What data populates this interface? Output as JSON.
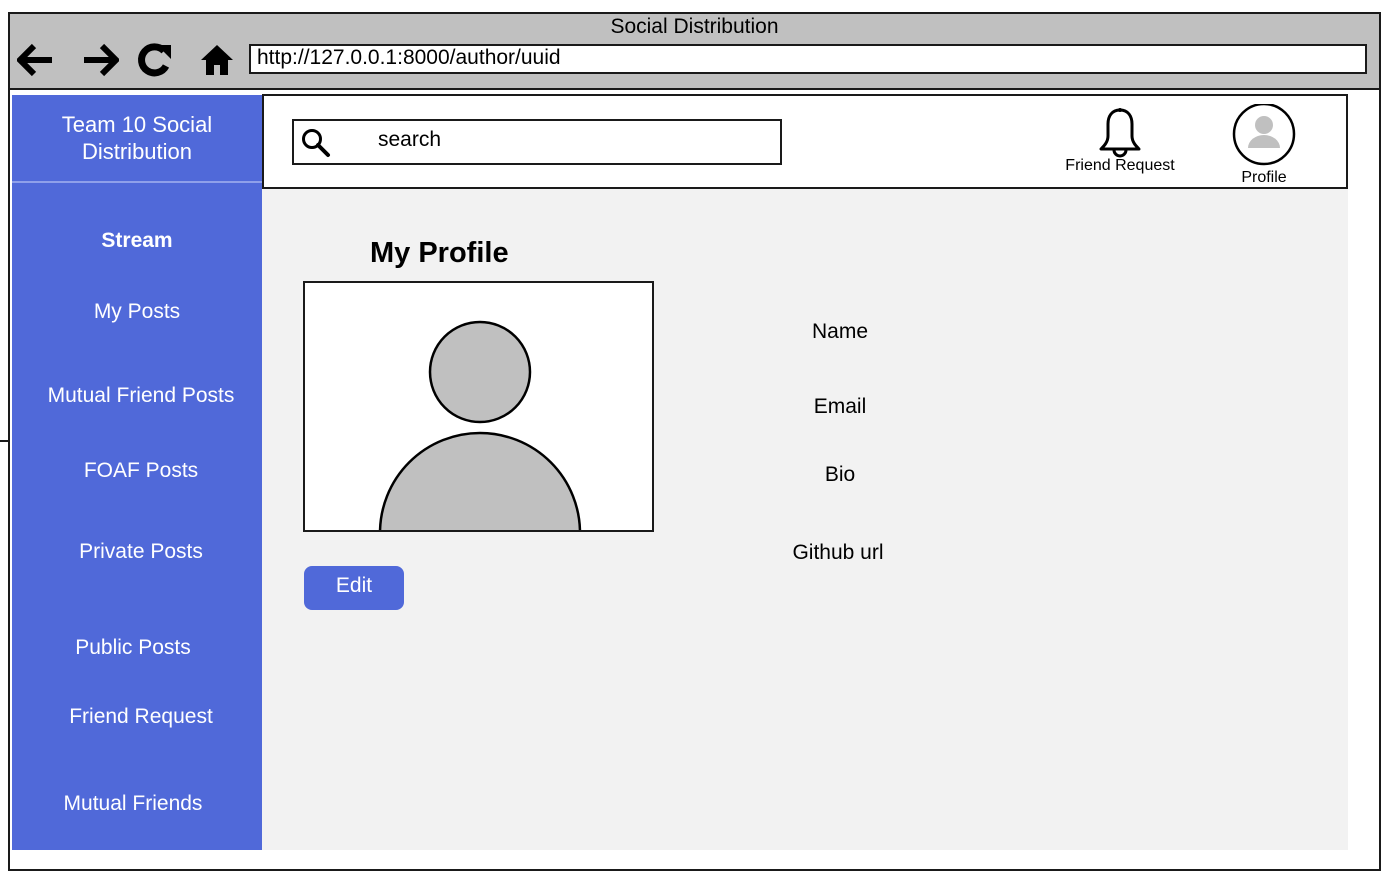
{
  "window": {
    "title": "Social Distribution",
    "url": "http://127.0.0.1:8000/author/uuid"
  },
  "nav_icons": [
    "back-arrow-icon",
    "forward-arrow-icon",
    "reload-icon",
    "home-icon"
  ],
  "sidebar": {
    "brand": "Team 10 Social Distribution",
    "items": [
      {
        "label": "Stream",
        "active": true
      },
      {
        "label": "My Posts",
        "active": false
      },
      {
        "label": "Mutual Friend Posts",
        "active": false
      },
      {
        "label": "FOAF Posts",
        "active": false
      },
      {
        "label": "Private Posts",
        "active": false
      },
      {
        "label": "Public Posts",
        "active": false
      },
      {
        "label": "Friend Request",
        "active": false
      },
      {
        "label": "Mutual Friends",
        "active": false
      }
    ]
  },
  "topbar": {
    "search_placeholder": "search",
    "friend_request_label": "Friend Request",
    "profile_label": "Profile"
  },
  "profile": {
    "title": "My Profile",
    "fields": [
      "Name",
      "Email",
      "Bio",
      "Github url"
    ],
    "edit_label": "Edit"
  },
  "colors": {
    "accent": "#5069d9",
    "titlebar": "#c0c0c0",
    "content_bg": "#f2f2f2",
    "avatar_fill": "#c0c0c0"
  }
}
